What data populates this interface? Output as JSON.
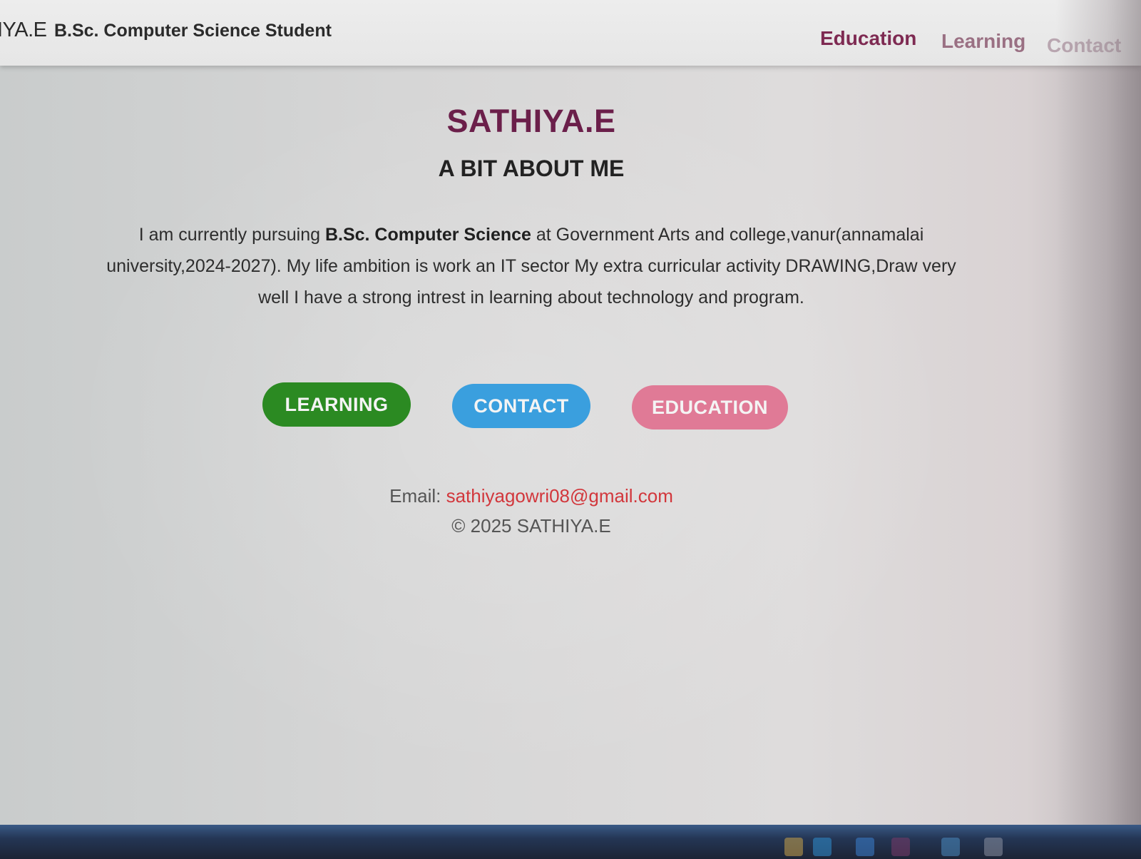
{
  "header": {
    "brand_name": "IYA.E",
    "brand_tagline": "B.Sc. Computer Science Student",
    "nav": {
      "education": "Education",
      "learning": "Learning",
      "contact": "Contact"
    }
  },
  "main": {
    "title": "SATHIYA.E",
    "subtitle": "A BIT ABOUT ME",
    "about": {
      "before": "I am currently pursuing ",
      "highlight": "B.Sc. Computer Science",
      "after": " at Government Arts and college,vanur(annamalai university,2024-2027). My life ambition is work an IT sector My extra curricular activity DRAWING,Draw very well I have a strong intrest in learning about technology and program."
    },
    "buttons": {
      "learning": "LEARNING",
      "contact": "CONTACT",
      "education": "EDUCATION"
    }
  },
  "footer": {
    "email_label": "Email: ",
    "email": "sathiyagowri08@gmail.com",
    "copyright": "© 2025 SATHIYA.E"
  },
  "colors": {
    "accent": "#6b1f4a",
    "learning_button": "#2b8a22",
    "contact_button": "#3a9fde",
    "education_button": "#e07a96",
    "email_link": "#d2373c"
  },
  "taskbar": {
    "icons": [
      "folder-icon",
      "browser-icon",
      "store-icon",
      "app-icon",
      "mail-icon",
      "settings-icon"
    ]
  }
}
